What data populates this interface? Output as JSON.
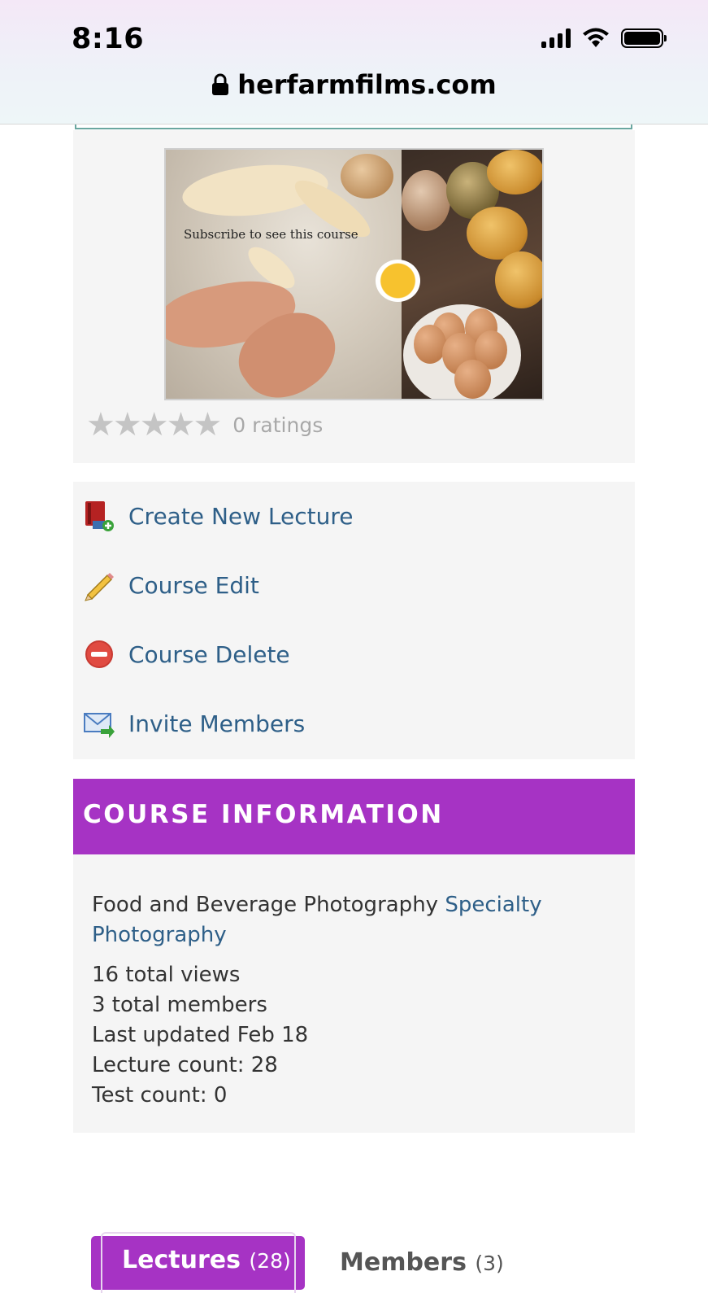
{
  "status_bar": {
    "time": "8:16"
  },
  "browser": {
    "url": "herfarmfilms.com"
  },
  "course": {
    "image_overlay_text": "Subscribe to see this course",
    "rating_stars": 0,
    "ratings_text": "0 ratings"
  },
  "actions": [
    {
      "label": "Create New Lecture",
      "icon": "book-add-icon"
    },
    {
      "label": "Course Edit",
      "icon": "pencil-icon"
    },
    {
      "label": "Course Delete",
      "icon": "delete-icon"
    },
    {
      "label": "Invite Members",
      "icon": "envelope-arrow-icon"
    }
  ],
  "info": {
    "header": "COURSE INFORMATION",
    "course_name": "Food and Beverage Photography",
    "category_line1": "Specialty",
    "category_line2": "Photography",
    "views": "16 total views",
    "members": "3 total members",
    "updated": "Last updated Feb 18",
    "lecture_count": "Lecture count: 28",
    "test_count": "Test count: 0"
  },
  "tabs": {
    "lectures_label": "Lectures",
    "lectures_count": "(28)",
    "members_label": "Members",
    "members_count": "(3)"
  },
  "colors": {
    "accent": "#a633c4",
    "link": "#2e5f88",
    "panel": "#f5f5f5"
  }
}
